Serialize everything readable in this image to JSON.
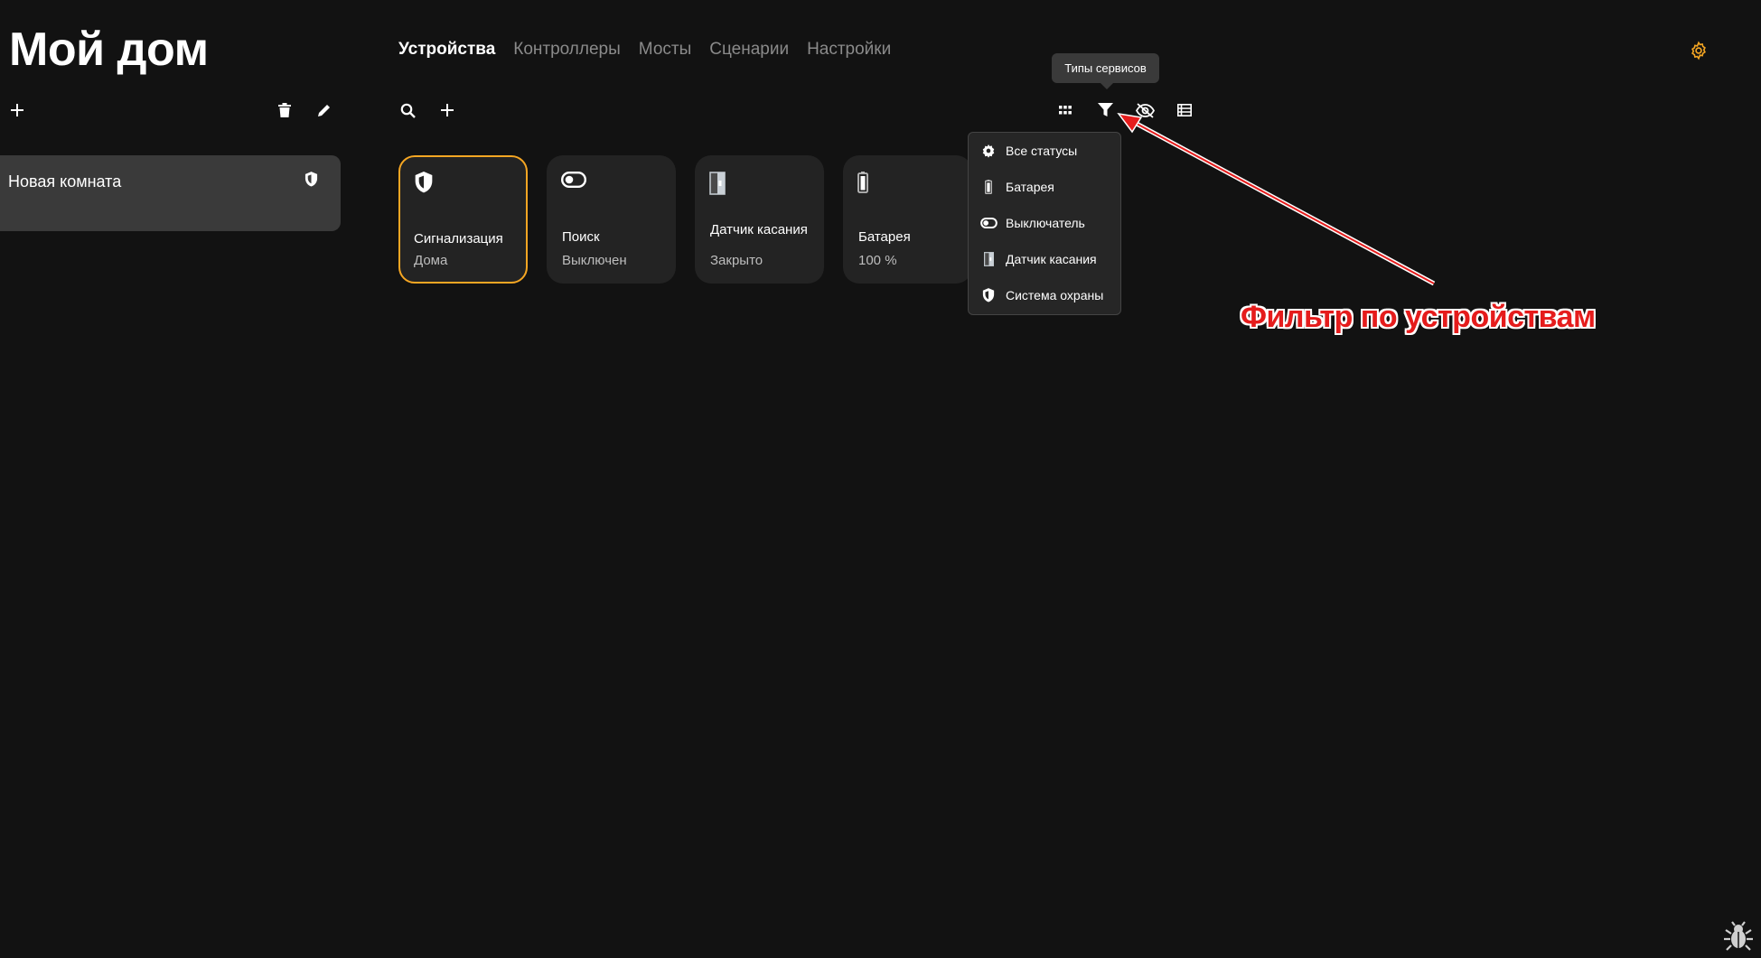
{
  "header": {
    "title": "Мой дом",
    "tabs": [
      {
        "label": "Устройства",
        "active": true
      },
      {
        "label": "Контроллеры",
        "active": false
      },
      {
        "label": "Мосты",
        "active": false
      },
      {
        "label": "Сценарии",
        "active": false
      },
      {
        "label": "Настройки",
        "active": false
      }
    ]
  },
  "sidebar": {
    "room": {
      "name": "Новая комната",
      "icon": "shield-icon"
    }
  },
  "devices": [
    {
      "name": "Сигнализация",
      "state": "Дома",
      "icon": "shield-icon",
      "selected": true
    },
    {
      "name": "Поиск",
      "state": "Выключен",
      "icon": "toggle-icon",
      "selected": false
    },
    {
      "name": "Датчик касания",
      "state": "Закрыто",
      "icon": "contact-sensor-icon",
      "selected": false
    },
    {
      "name": "Батарея",
      "state": "100 %",
      "icon": "battery-icon",
      "selected": false
    }
  ],
  "toolbar": {
    "tooltip": "Типы сервисов"
  },
  "filter_menu": {
    "items": [
      {
        "label": "Все статусы",
        "icon": "gear-icon"
      },
      {
        "label": "Батарея",
        "icon": "battery-icon"
      },
      {
        "label": "Выключатель",
        "icon": "toggle-icon"
      },
      {
        "label": "Датчик касания",
        "icon": "contact-sensor-icon"
      },
      {
        "label": "Система охраны",
        "icon": "shield-icon"
      }
    ]
  },
  "annotation": {
    "text": "Фильтр по устройствам",
    "color": "#e51c1c"
  },
  "colors": {
    "accent": "#f5a623",
    "background": "#121212"
  }
}
